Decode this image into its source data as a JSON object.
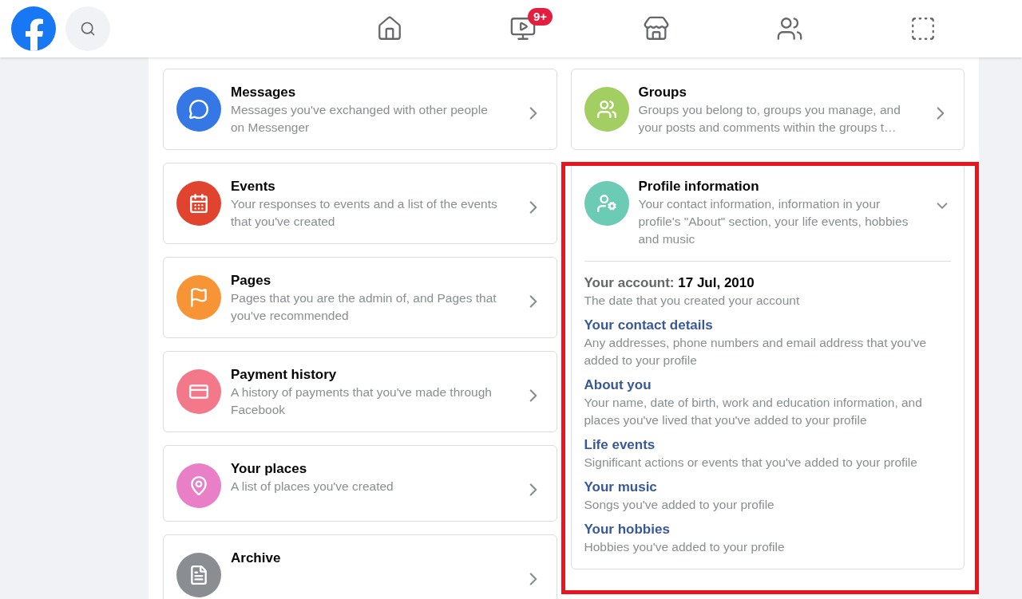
{
  "topbar": {
    "nav": [
      {
        "kind": "home"
      },
      {
        "kind": "watch",
        "badge": "9+"
      },
      {
        "kind": "marketplace"
      },
      {
        "kind": "groups"
      },
      {
        "kind": "gaming"
      }
    ]
  },
  "left_cards": [
    {
      "kind": "messages",
      "title": "Messages",
      "description": "Messages you've exchanged with other people on Messenger",
      "color": "#3578e5",
      "expanded": false
    },
    {
      "kind": "events",
      "title": "Events",
      "description": "Your responses to events and a list of the events that you've created",
      "color": "#e0442f",
      "expanded": false
    },
    {
      "kind": "pages",
      "title": "Pages",
      "description": "Pages that you are the admin of, and Pages that you've recommended",
      "color": "#f79536",
      "expanded": false
    },
    {
      "kind": "payment",
      "title": "Payment history",
      "description": "A history of payments that you've made through Facebook",
      "color": "#f2788a",
      "expanded": false
    },
    {
      "kind": "places",
      "title": "Your places",
      "description": "A list of places you've created",
      "color": "#e97fc6",
      "expanded": false
    },
    {
      "kind": "archive",
      "title": "Archive",
      "color": "#8a8d91",
      "expanded": false
    }
  ],
  "right_cards": [
    {
      "kind": "groups",
      "title": "Groups",
      "description": "Groups you belong to, groups you manage, and your posts and comments within the groups t…",
      "color": "#a3cf62",
      "expanded": false
    },
    {
      "kind": "profile",
      "title": "Profile information",
      "description": "Your contact information, information in your profile's \"About\" section, your life events, hobbies and music",
      "color": "#6bcbb4",
      "expanded": true,
      "account": {
        "label": "Your account:",
        "value": "17 Jul, 2010",
        "description": "The date that you created your account"
      },
      "sections": [
        {
          "title": "Your contact details",
          "description": "Any addresses, phone numbers and email address that you've added to your profile"
        },
        {
          "title": "About you",
          "description": "Your name, date of birth, work and education information, and places you've lived that you've added to your profile"
        },
        {
          "title": "Life events",
          "description": "Significant actions or events that you've added to your profile"
        },
        {
          "title": "Your music",
          "description": "Songs you've added to your profile"
        },
        {
          "title": "Your hobbies",
          "description": "Hobbies you've added to your profile"
        }
      ]
    }
  ],
  "highlight": {
    "on": true
  }
}
